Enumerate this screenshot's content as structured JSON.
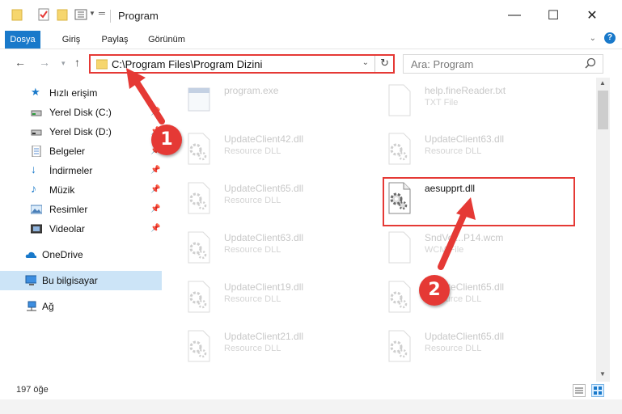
{
  "window": {
    "title": "Program",
    "controls": {
      "minimize": "—",
      "maximize": "☐",
      "close": "✕"
    }
  },
  "ribbon": {
    "tabs": [
      {
        "label": "Dosya",
        "active": true
      },
      {
        "label": "Giriş",
        "active": false
      },
      {
        "label": "Paylaş",
        "active": false
      },
      {
        "label": "Görünüm",
        "active": false
      }
    ],
    "expand_icon": "chevron-down-icon",
    "help_label": "?"
  },
  "navigation": {
    "address": "C:\\Program Files\\Program Dizini",
    "search_placeholder": "Ara: Program"
  },
  "sidebar": {
    "items": [
      {
        "label": "Hızlı erişim",
        "icon": "star-icon",
        "pinned": false
      },
      {
        "label": "Yerel Disk (C:)",
        "icon": "drive-icon",
        "pinned": true
      },
      {
        "label": "Yerel Disk (D:)",
        "icon": "drive-icon",
        "pinned": true
      },
      {
        "label": "Belgeler",
        "icon": "documents-icon",
        "pinned": true
      },
      {
        "label": "İndirmeler",
        "icon": "download-icon",
        "pinned": true
      },
      {
        "label": "Müzik",
        "icon": "music-icon",
        "pinned": true
      },
      {
        "label": "Resimler",
        "icon": "pictures-icon",
        "pinned": true
      },
      {
        "label": "Videolar",
        "icon": "videos-icon",
        "pinned": true
      },
      {
        "label": "OneDrive",
        "icon": "cloud-icon",
        "pinned": false
      },
      {
        "label": "Bu bilgisayar",
        "icon": "computer-icon",
        "pinned": false,
        "selected": true
      },
      {
        "label": "Ağ",
        "icon": "network-icon",
        "pinned": false
      }
    ]
  },
  "files": [
    {
      "name": "program.exe",
      "type": "",
      "icon": "exe-icon",
      "faded": true
    },
    {
      "name": "help.fineReader.txt",
      "type": "TXT File",
      "icon": "text-file-icon",
      "faded": true
    },
    {
      "name": "UpdateClient42.dll",
      "type": "Resource DLL",
      "icon": "dll-gear-icon",
      "faded": true
    },
    {
      "name": "UpdateClient63.dll",
      "type": "Resource DLL",
      "icon": "dll-gear-icon",
      "faded": true
    },
    {
      "name": "UpdateClient65.dll",
      "type": "Resource DLL",
      "icon": "dll-gear-icon",
      "faded": true
    },
    {
      "name": "aesupprt.dll",
      "type": "",
      "icon": "dll-gear-icon",
      "faded": false
    },
    {
      "name": "UpdateClient63.dll",
      "type": "Resource DLL",
      "icon": "dll-gear-icon",
      "faded": true
    },
    {
      "name": "SndVol...P14.wcm",
      "type": "WCM File",
      "icon": "blank-file-icon",
      "faded": true
    },
    {
      "name": "UpdateClient19.dll",
      "type": "Resource DLL",
      "icon": "dll-gear-icon",
      "faded": true
    },
    {
      "name": "UpdateClient65.dll",
      "type": "Resource DLL",
      "icon": "dll-gear-icon",
      "faded": true
    },
    {
      "name": "UpdateClient21.dll",
      "type": "Resource DLL",
      "icon": "dll-gear-icon",
      "faded": true
    },
    {
      "name": "UpdateClient65.dll",
      "type": "Resource DLL",
      "icon": "dll-gear-icon",
      "faded": true
    }
  ],
  "status": {
    "count": "197 öğe"
  },
  "annotations": {
    "step1": "1",
    "step2": "2",
    "color": "#e53935"
  },
  "colors": {
    "accent": "#1979ca",
    "highlight": "#e53935",
    "selection": "#cce4f7"
  }
}
